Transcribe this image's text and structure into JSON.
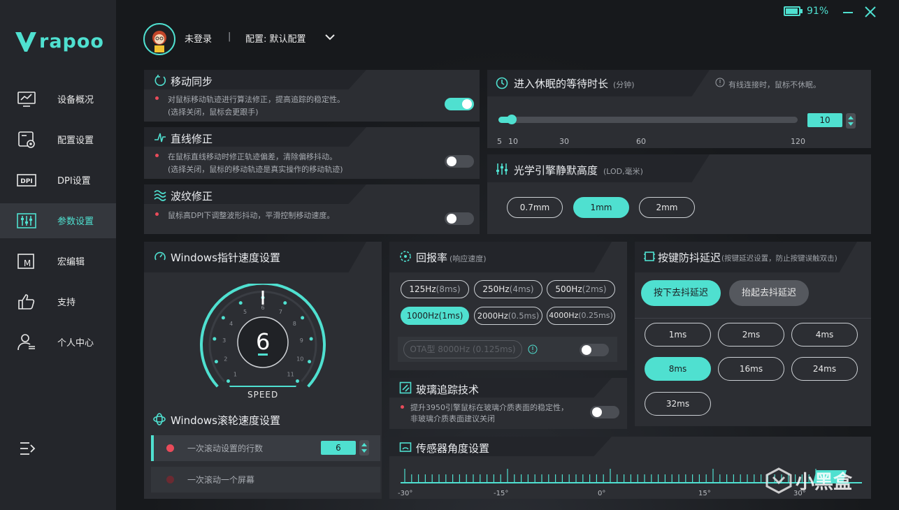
{
  "window": {
    "battery": "91%"
  },
  "brand": {
    "name": "rapoo"
  },
  "header": {
    "user": "未登录",
    "separator": "|",
    "config_label": "配置: 默认配置"
  },
  "nav": {
    "items": [
      {
        "label": "设备概况",
        "icon": "monitor-chart-icon"
      },
      {
        "label": "配置设置",
        "icon": "config-gear-icon"
      },
      {
        "label": "DPI设置",
        "icon": "dpi-icon"
      },
      {
        "label": "参数设置",
        "icon": "sliders-icon"
      },
      {
        "label": "宏编辑",
        "icon": "macro-icon"
      },
      {
        "label": "支持",
        "icon": "thumbs-up-icon"
      },
      {
        "label": "个人中心",
        "icon": "user-center-icon"
      }
    ]
  },
  "motion_sync": {
    "title": "移动同步",
    "desc1": "对鼠标移动轨迹进行算法修正，提高追踪的稳定性。",
    "desc2": "(选择关闭，鼠标会更跟手)",
    "enabled": true
  },
  "angle_snap": {
    "title": "直线修正",
    "desc1": "在鼠标直线移动时修正轨迹偏差，清除偏移抖动。",
    "desc2": "(选择关闭，鼠标的移动轨迹是真实操作的移动轨迹)",
    "enabled": false
  },
  "ripple": {
    "title": "波纹修正",
    "desc1": "鼠标高DPI下调整波形抖动，平滑控制移动速度。",
    "enabled": false
  },
  "sleep": {
    "title": "进入休眠的等待时长",
    "unit": "(分钟)",
    "note": "有线连接时，鼠标不休眠。",
    "value": "10",
    "ticks": [
      "5",
      "10",
      "30",
      "60",
      "120"
    ]
  },
  "lod": {
    "title": "光学引擎静默高度",
    "unit": "(LOD,毫米)",
    "options": [
      "0.7mm",
      "1mm",
      "2mm"
    ],
    "selected": "1mm"
  },
  "pointer_speed": {
    "title": "Windows指针速度设置",
    "value": "6",
    "dial_label": "SPEED",
    "dial_numbers": [
      "1",
      "2",
      "3",
      "4",
      "5",
      "6",
      "7",
      "8",
      "9",
      "10",
      "11"
    ]
  },
  "scroll": {
    "title": "Windows滚轮速度设置",
    "lines_label": "一次滚动设置的行数",
    "lines_value": "6",
    "screen_label": "一次滚动一个屏幕"
  },
  "polling": {
    "title": "回报率",
    "subtitle": "(响应速度)",
    "options": [
      {
        "rate": "125Hz",
        "ms": "(8ms)"
      },
      {
        "rate": "250Hz",
        "ms": "(4ms)"
      },
      {
        "rate": "500Hz",
        "ms": "(2ms)"
      },
      {
        "rate": "1000Hz",
        "ms": "(1ms)"
      },
      {
        "rate": "2000Hz",
        "ms": "(0.5ms)"
      },
      {
        "rate": "4000Hz",
        "ms": "(0.25ms)"
      }
    ],
    "selected": "1000Hz",
    "ota_label": "OTA型 8000Hz (0.125ms)",
    "ota_enabled": false
  },
  "glass": {
    "title": "玻璃追踪技术",
    "desc1": "提升3950引擎鼠标在玻璃介质表面的稳定性，",
    "desc2": "非玻璃介质表面建议关闭",
    "enabled": false
  },
  "debounce": {
    "title": "按键防抖延迟",
    "subtitle": "(按键延迟设置，防止按键误触双击)",
    "tabs": [
      "按下去抖延迟",
      "抬起去抖延迟"
    ],
    "active_tab": "按下去抖延迟",
    "options": [
      "1ms",
      "2ms",
      "4ms",
      "8ms",
      "16ms",
      "24ms",
      "32ms"
    ],
    "selected": "8ms"
  },
  "sensor_angle": {
    "title": "传感器角度设置",
    "ticks": [
      "-30°",
      "-15°",
      "0°",
      "15°",
      "30°"
    ]
  },
  "watermark": {
    "text": "小黑盒"
  },
  "colors": {
    "accent": "#4fe0d0",
    "panel": "#2c2e33",
    "sidebar": "#24262b",
    "alert": "#e94b5a"
  }
}
